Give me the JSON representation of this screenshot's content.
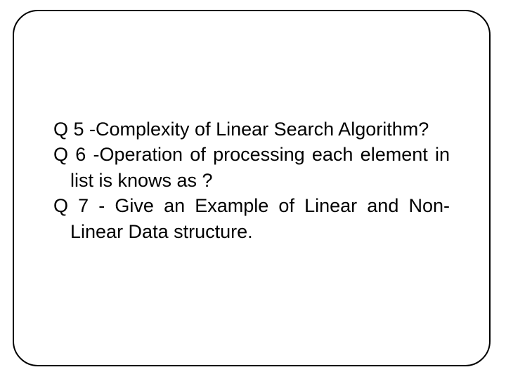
{
  "questions": {
    "q5": "Q 5 -Complexity of Linear Search Algorithm?",
    "q6": "Q 6 -Operation of processing each element in list is knows as ?",
    "q7": "Q 7 - Give an Example of Linear and Non-Linear Data structure."
  }
}
